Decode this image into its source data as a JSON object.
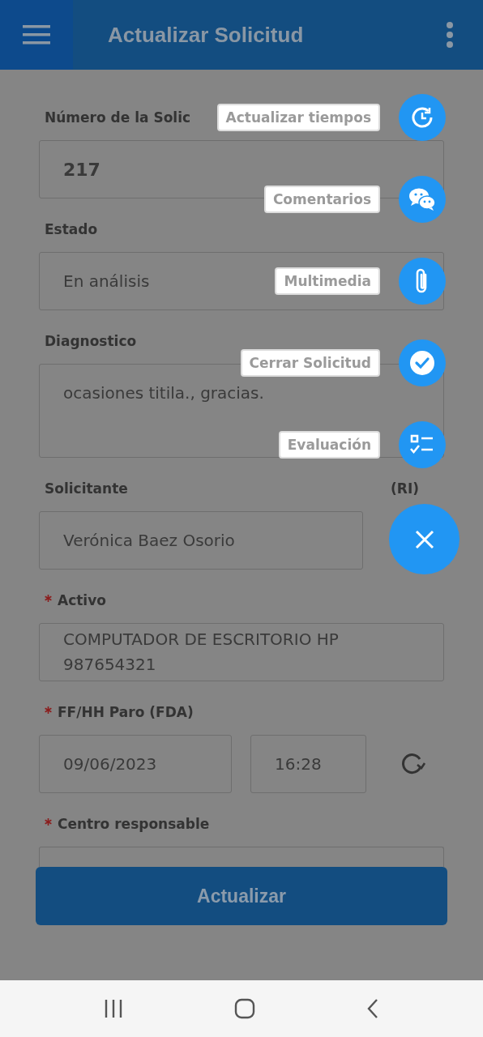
{
  "app_bar": {
    "title": "Actualizar Solicitud"
  },
  "fields": [
    {
      "kind": "number",
      "label": "Número de la Solic",
      "required": false,
      "value": "217"
    },
    {
      "kind": "single",
      "label": "Estado",
      "required": false,
      "value": "En análisis"
    },
    {
      "kind": "multi",
      "label": "Diagnostico",
      "required": false,
      "value": "ocasiones titila., gracias."
    },
    {
      "kind": "narrow",
      "label": "Solicitante",
      "side_label": "(RI)",
      "required": false,
      "value": "Verónica Baez Osorio"
    },
    {
      "kind": "single",
      "label": "Activo",
      "required": true,
      "value": "COMPUTADOR DE ESCRITORIO HP\n987654321"
    },
    {
      "kind": "datetime",
      "label": "FF/HH Paro (FDA)",
      "required": true,
      "date": "09/06/2023",
      "time": "16:28"
    },
    {
      "kind": "cut",
      "label": "Centro responsable",
      "required": true
    }
  ],
  "submit_button": "Actualizar",
  "speed_dial": {
    "actions": [
      {
        "kind": "clock",
        "label": "Actualizar tiempos"
      },
      {
        "kind": "chat",
        "label": "Comentarios"
      },
      {
        "kind": "clip",
        "label": "Multimedia"
      },
      {
        "kind": "check",
        "label": "Cerrar Solicitud"
      },
      {
        "kind": "checklist",
        "label": "Evaluación"
      }
    ]
  }
}
